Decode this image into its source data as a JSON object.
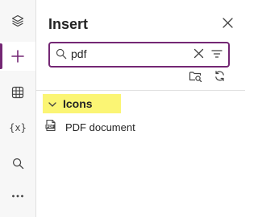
{
  "rail": {
    "items": [
      {
        "name": "layers",
        "icon": "layers-icon",
        "active": false
      },
      {
        "name": "insert",
        "icon": "plus-icon",
        "active": true
      },
      {
        "name": "data",
        "icon": "table-icon",
        "active": false
      },
      {
        "name": "variables",
        "icon": "variables-icon",
        "label": "{x}",
        "active": false
      },
      {
        "name": "search",
        "icon": "search-icon",
        "active": false
      },
      {
        "name": "more",
        "icon": "more-icon",
        "active": false
      }
    ]
  },
  "panel": {
    "title": "Insert",
    "search": {
      "value": "pdf",
      "placeholder": "Search"
    },
    "groups": [
      {
        "label": "Icons",
        "expanded": true,
        "highlight": "#fbf574",
        "items": [
          {
            "label": "PDF document",
            "icon": "pdf-icon"
          }
        ]
      }
    ]
  },
  "colors": {
    "accent": "#742774",
    "highlight": "#fbf574"
  }
}
